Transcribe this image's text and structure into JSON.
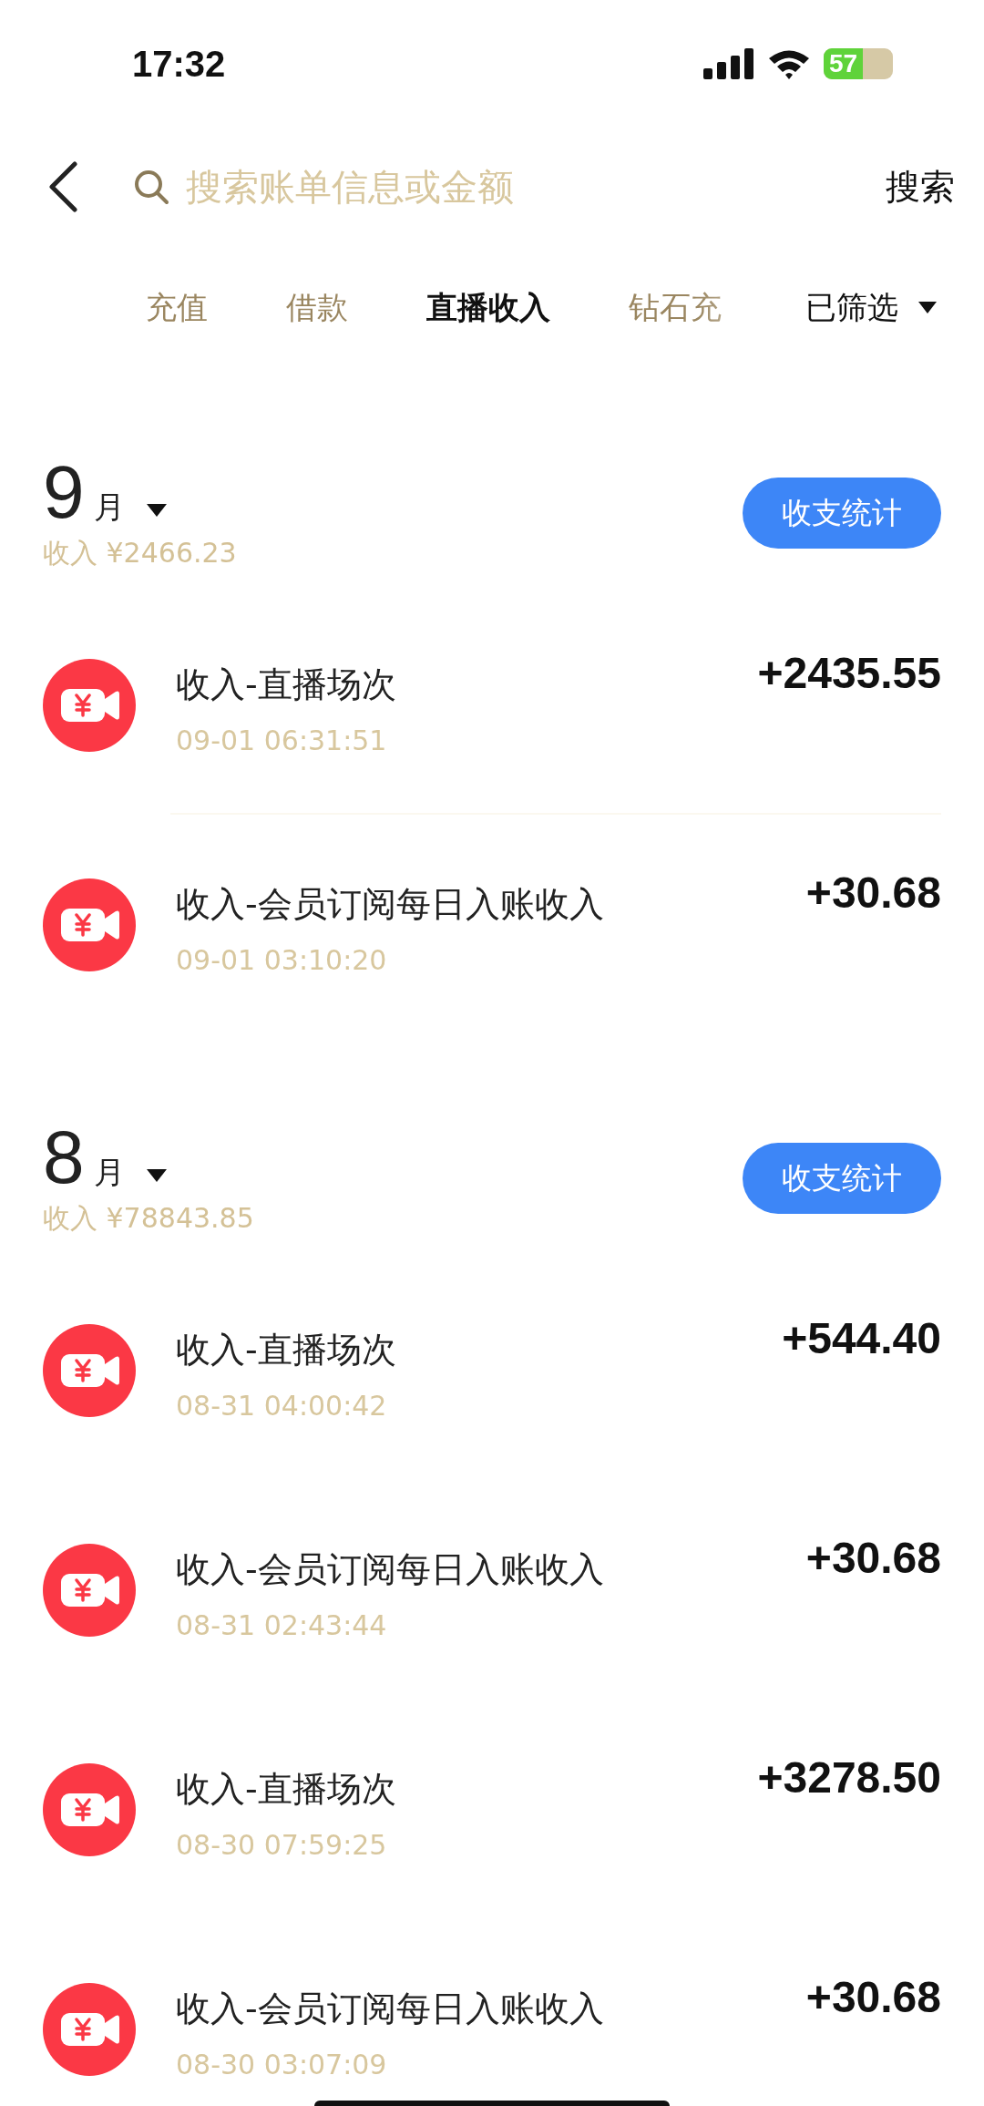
{
  "status_bar": {
    "time": "17:32",
    "battery": "57"
  },
  "search": {
    "placeholder": "搜索账单信息或金额",
    "button": "搜索"
  },
  "tabs": [
    {
      "label": "充值",
      "selected": false
    },
    {
      "label": "借款",
      "selected": false
    },
    {
      "label": "直播收入",
      "selected": true
    },
    {
      "label": "钻石充",
      "selected": false
    }
  ],
  "filter": {
    "label": "已筛选"
  },
  "months": [
    {
      "month": "9",
      "unit": "月",
      "income": "收入 ¥2466.23",
      "stats_button": "收支统计",
      "transactions": [
        {
          "title": "收入-直播场次",
          "time": "09-01 06:31:51",
          "amount": "+2435.55"
        },
        {
          "title": "收入-会员订阅每日入账收入",
          "time": "09-01 03:10:20",
          "amount": "+30.68"
        }
      ]
    },
    {
      "month": "8",
      "unit": "月",
      "income": "收入 ¥78843.85",
      "stats_button": "收支统计",
      "transactions": [
        {
          "title": "收入-直播场次",
          "time": "08-31 04:00:42",
          "amount": "+544.40"
        },
        {
          "title": "收入-会员订阅每日入账收入",
          "time": "08-31 02:43:44",
          "amount": "+30.68"
        },
        {
          "title": "收入-直播场次",
          "time": "08-30 07:59:25",
          "amount": "+3278.50"
        },
        {
          "title": "收入-会员订阅每日入账收入",
          "time": "08-30 03:07:09",
          "amount": "+30.68"
        }
      ]
    }
  ]
}
